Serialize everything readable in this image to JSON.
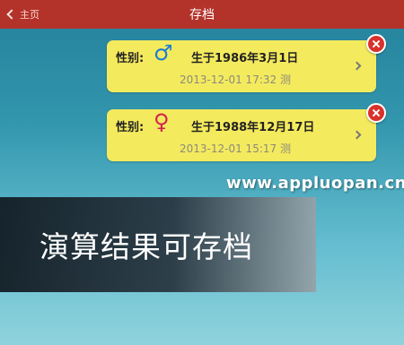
{
  "navbar": {
    "back_label": "主页",
    "title": "存档",
    "background": "#b3322a"
  },
  "records": [
    {
      "gender_label": "性别:",
      "gender_symbol": "♂",
      "gender_icon": "male-icon",
      "birth": "生于1986年3月1日",
      "time": "2013-12-01 17:32 测"
    },
    {
      "gender_label": "性别:",
      "gender_symbol": "♀",
      "gender_icon": "female-icon",
      "birth": "生于1988年12月17日",
      "time": "2013-12-01 15:17 测"
    }
  ],
  "watermark": "www.appluopan.cn",
  "banner": {
    "text": "演算结果可存档"
  },
  "colors": {
    "card": "#f4ea5e",
    "delete": "#d8312b",
    "male": "#1a7bd4",
    "female": "#d2224f"
  }
}
